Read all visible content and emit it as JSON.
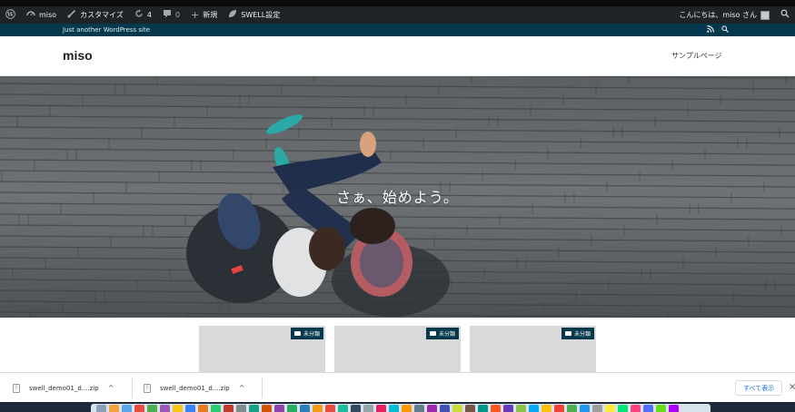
{
  "adminbar": {
    "site_name": "miso",
    "customize": "カスタマイズ",
    "updates_count": "4",
    "comments_count": "0",
    "new_label": "新規",
    "swell_settings": "SWELL設定",
    "greeting": "こんにちは、miso さん",
    "icons": [
      "wordpress-icon",
      "dashboard-icon",
      "brush-icon",
      "refresh-icon",
      "comment-icon",
      "plus-icon",
      "leaf-icon",
      "search-icon"
    ]
  },
  "infobar": {
    "tagline": "Just another WordPress site",
    "icons": [
      "rss-icon",
      "search-icon"
    ]
  },
  "header": {
    "site_title": "miso",
    "nav_items": [
      "サンプルページ"
    ]
  },
  "hero": {
    "heading": "さぁ、始めよう。"
  },
  "posts": {
    "cards": [
      {
        "category": "未分類"
      },
      {
        "category": "未分類"
      },
      {
        "category": "未分類"
      }
    ]
  },
  "downloads": {
    "items": [
      {
        "filename": "swell_demo01_d....zip"
      },
      {
        "filename": "swell_demo01_d....zip"
      }
    ],
    "show_all": "すべて表示"
  },
  "colors": {
    "adminbar": "#1d2327",
    "infobar": "#04384c",
    "category_badge": "#04384c",
    "show_all_text": "#1a73e8"
  },
  "dock_colors": [
    "#8aa0b8",
    "#f2a23a",
    "#5aa6e8",
    "#e84c3d",
    "#4caf50",
    "#9b59b6",
    "#f5c518",
    "#3b82f6",
    "#e67e22",
    "#2ecc71",
    "#c0392b",
    "#7f8c8d",
    "#16a085",
    "#d35400",
    "#8e44ad",
    "#27ae60",
    "#2980b9",
    "#f39c12",
    "#e74c3c",
    "#1abc9c",
    "#34495e",
    "#95a5a6",
    "#e91e63",
    "#00bcd4",
    "#ff9800",
    "#607d8b",
    "#9c27b0",
    "#3f51b5",
    "#cddc39",
    "#795548",
    "#009688",
    "#ff5722",
    "#673ab7",
    "#8bc34a",
    "#03a9f4",
    "#ffc107",
    "#f44336",
    "#4caf50",
    "#2196f3",
    "#9e9e9e",
    "#ffeb3b",
    "#00e676",
    "#ff4081",
    "#536dfe",
    "#64dd17",
    "#aa00ff"
  ]
}
